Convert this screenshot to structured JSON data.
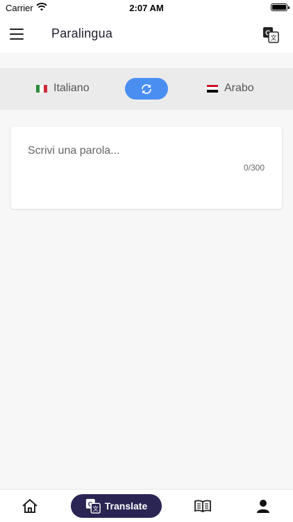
{
  "status_bar": {
    "carrier": "Carrier",
    "time": "2:07 AM",
    "icons": [
      "wifi-icon",
      "battery-icon"
    ]
  },
  "header": {
    "title": "Paralingua",
    "icons": [
      "menu-icon",
      "translate-icon"
    ]
  },
  "language_bar": {
    "source_language": "Italiano",
    "target_language": "Arabo",
    "swap_icon": "swap-icon",
    "swap_color": "#4a8ef2"
  },
  "input": {
    "placeholder": "Scrivi una parola...",
    "value": "",
    "counter": "0/300"
  },
  "bottom_nav": {
    "items": [
      {
        "icon": "home-icon",
        "label": ""
      },
      {
        "icon": "translate-icon",
        "label": "Translate",
        "active": true
      },
      {
        "icon": "book-icon",
        "label": ""
      },
      {
        "icon": "user-icon",
        "label": ""
      }
    ],
    "active_color": "#2a2553"
  }
}
